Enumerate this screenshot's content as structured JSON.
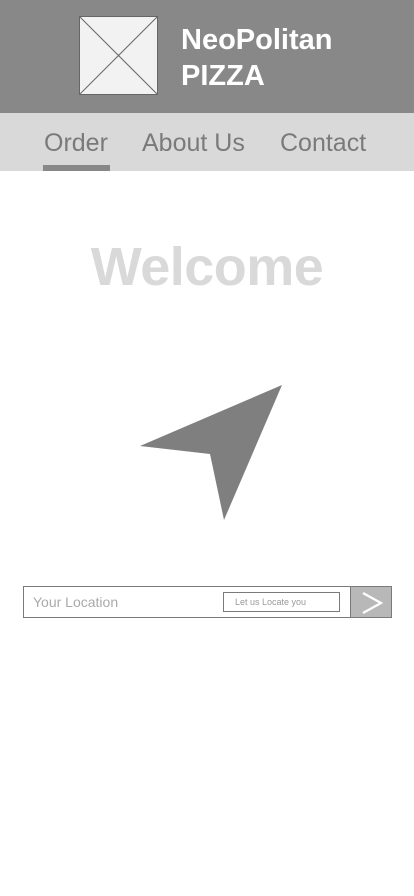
{
  "header": {
    "brand_line1": "NeoPolitan",
    "brand_line2": "PIZZA",
    "logo_icon": "image-placeholder-icon"
  },
  "nav": {
    "tabs": [
      {
        "label": "Order",
        "active": true
      },
      {
        "label": "About Us",
        "active": false
      },
      {
        "label": "Contact",
        "active": false
      }
    ]
  },
  "main": {
    "welcome": "Welcome",
    "hero_icon": "navigation-arrow-icon"
  },
  "location": {
    "placeholder": "Your Location",
    "value": "",
    "locate_label": "Let us Locate you",
    "submit_icon": "chevron-right-icon"
  },
  "colors": {
    "header_bg": "#888888",
    "nav_bg": "#d9d9d9",
    "tab_text": "#7a7a7a",
    "welcome_text": "#d9d9d9",
    "icon_fill": "#7f7f7f",
    "submit_bg": "#b8b8b8"
  }
}
